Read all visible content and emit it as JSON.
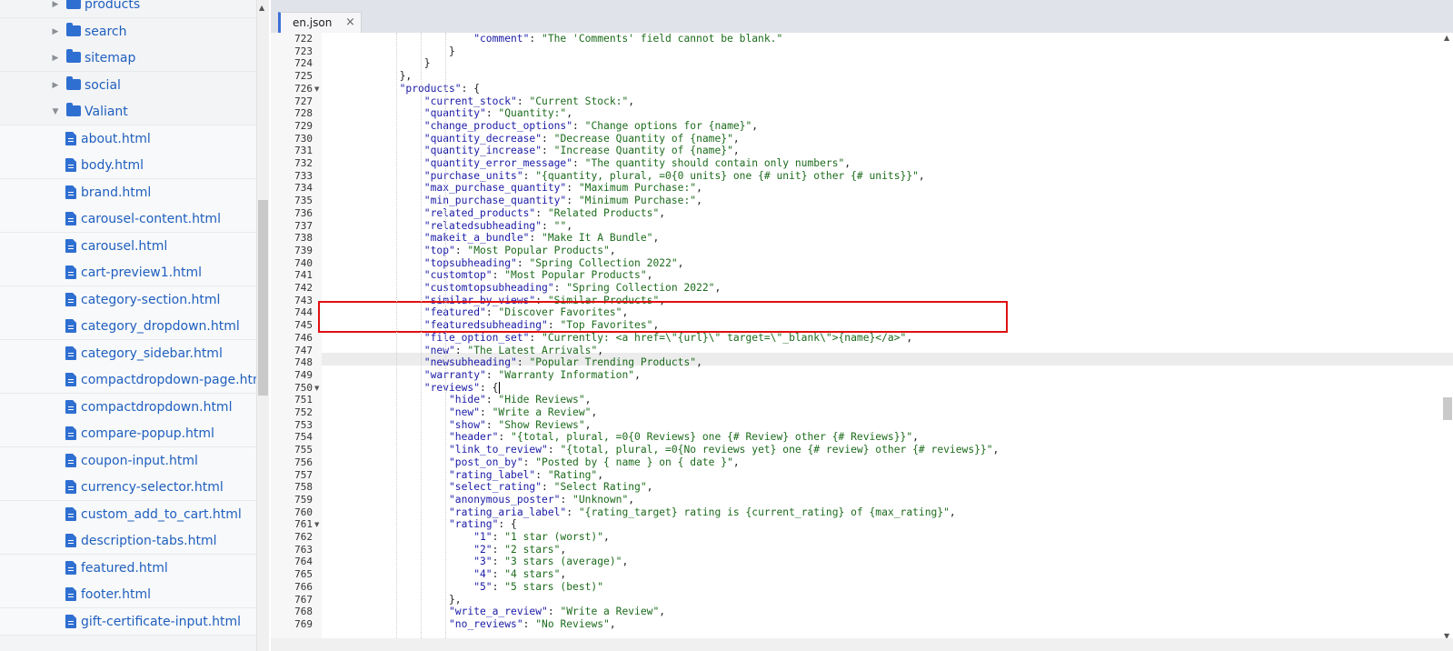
{
  "file_tree": {
    "items": [
      {
        "type": "folder",
        "label": "products",
        "level": 0,
        "expanded": false
      },
      {
        "type": "folder",
        "label": "search",
        "level": 0,
        "expanded": false
      },
      {
        "type": "folder",
        "label": "sitemap",
        "level": 0,
        "expanded": false
      },
      {
        "type": "folder",
        "label": "social",
        "level": 0,
        "expanded": false
      },
      {
        "type": "folder",
        "label": "Valiant",
        "level": 0,
        "expanded": true
      },
      {
        "type": "file",
        "label": "about.html",
        "level": 1
      },
      {
        "type": "file",
        "label": "body.html",
        "level": 1
      },
      {
        "type": "file",
        "label": "brand.html",
        "level": 1
      },
      {
        "type": "file",
        "label": "carousel-content.html",
        "level": 1
      },
      {
        "type": "file",
        "label": "carousel.html",
        "level": 1
      },
      {
        "type": "file",
        "label": "cart-preview1.html",
        "level": 1
      },
      {
        "type": "file",
        "label": "category-section.html",
        "level": 1
      },
      {
        "type": "file",
        "label": "category_dropdown.html",
        "level": 1
      },
      {
        "type": "file",
        "label": "category_sidebar.html",
        "level": 1
      },
      {
        "type": "file",
        "label": "compactdropdown-page.html",
        "level": 1
      },
      {
        "type": "file",
        "label": "compactdropdown.html",
        "level": 1
      },
      {
        "type": "file",
        "label": "compare-popup.html",
        "level": 1
      },
      {
        "type": "file",
        "label": "coupon-input.html",
        "level": 1
      },
      {
        "type": "file",
        "label": "currency-selector.html",
        "level": 1
      },
      {
        "type": "file",
        "label": "custom_add_to_cart.html",
        "level": 1
      },
      {
        "type": "file",
        "label": "description-tabs.html",
        "level": 1
      },
      {
        "type": "file",
        "label": "featured.html",
        "level": 1
      },
      {
        "type": "file",
        "label": "footer.html",
        "level": 1
      },
      {
        "type": "file",
        "label": "gift-certificate-input.html",
        "level": 1
      }
    ]
  },
  "editor": {
    "tab": {
      "label": "en.json",
      "close": "×"
    },
    "active_line": 750,
    "highlighted_lines": [
      744,
      745
    ],
    "lines": [
      {
        "n": 722,
        "indent": 6,
        "text": "\"comment\": \"The 'Comments' field cannot be blank.\""
      },
      {
        "n": 723,
        "indent": 5,
        "text": "}"
      },
      {
        "n": 724,
        "indent": 4,
        "text": "}"
      },
      {
        "n": 725,
        "indent": 3,
        "text": "},"
      },
      {
        "n": 726,
        "indent": 3,
        "text": "\"products\": {",
        "fold": true
      },
      {
        "n": 727,
        "indent": 4,
        "text": "\"current_stock\": \"Current Stock:\","
      },
      {
        "n": 728,
        "indent": 4,
        "text": "\"quantity\": \"Quantity:\","
      },
      {
        "n": 729,
        "indent": 4,
        "text": "\"change_product_options\": \"Change options for {name}\","
      },
      {
        "n": 730,
        "indent": 4,
        "text": "\"quantity_decrease\": \"Decrease Quantity of {name}\","
      },
      {
        "n": 731,
        "indent": 4,
        "text": "\"quantity_increase\": \"Increase Quantity of {name}\","
      },
      {
        "n": 732,
        "indent": 4,
        "text": "\"quantity_error_message\": \"The quantity should contain only numbers\","
      },
      {
        "n": 733,
        "indent": 4,
        "text": "\"purchase_units\": \"{quantity, plural, =0{0 units} one {# unit} other {# units}}\","
      },
      {
        "n": 734,
        "indent": 4,
        "text": "\"max_purchase_quantity\": \"Maximum Purchase:\","
      },
      {
        "n": 735,
        "indent": 4,
        "text": "\"min_purchase_quantity\": \"Minimum Purchase:\","
      },
      {
        "n": 736,
        "indent": 4,
        "text": "\"related_products\": \"Related Products\","
      },
      {
        "n": 737,
        "indent": 4,
        "text": "\"relatedsubheading\": \"\","
      },
      {
        "n": 738,
        "indent": 4,
        "text": "\"makeit_a_bundle\": \"Make It A Bundle\","
      },
      {
        "n": 739,
        "indent": 4,
        "text": "\"top\": \"Most Popular Products\","
      },
      {
        "n": 740,
        "indent": 4,
        "text": "\"topsubheading\": \"Spring Collection 2022\","
      },
      {
        "n": 741,
        "indent": 4,
        "text": "\"customtop\": \"Most Popular Products\","
      },
      {
        "n": 742,
        "indent": 4,
        "text": "\"customtopsubheading\": \"Spring Collection 2022\","
      },
      {
        "n": 743,
        "indent": 4,
        "text": "\"similar_by_views\": \"Similar Products\","
      },
      {
        "n": 744,
        "indent": 4,
        "text": "\"featured\": \"Discover Favorites\","
      },
      {
        "n": 745,
        "indent": 4,
        "text": "\"featuredsubheading\": \"Top Favorites\","
      },
      {
        "n": 746,
        "indent": 4,
        "text": "\"file_option_set\": \"Currently: <a href=\\\"{url}\\\" target=\\\"_blank\\\">{name}</a>\","
      },
      {
        "n": 747,
        "indent": 4,
        "text": "\"new\": \"The Latest Arrivals\","
      },
      {
        "n": 748,
        "indent": 4,
        "text": "\"newsubheading\": \"Popular Trending Products\","
      },
      {
        "n": 749,
        "indent": 4,
        "text": "\"warranty\": \"Warranty Information\","
      },
      {
        "n": 750,
        "indent": 4,
        "text": "\"reviews\": {",
        "fold": true
      },
      {
        "n": 751,
        "indent": 5,
        "text": "\"hide\": \"Hide Reviews\","
      },
      {
        "n": 752,
        "indent": 5,
        "text": "\"new\": \"Write a Review\","
      },
      {
        "n": 753,
        "indent": 5,
        "text": "\"show\": \"Show Reviews\","
      },
      {
        "n": 754,
        "indent": 5,
        "text": "\"header\": \"{total, plural, =0{0 Reviews} one {# Review} other {# Reviews}}\","
      },
      {
        "n": 755,
        "indent": 5,
        "text": "\"link_to_review\": \"{total, plural, =0{No reviews yet} one {# review} other {# reviews}}\","
      },
      {
        "n": 756,
        "indent": 5,
        "text": "\"post_on_by\": \"Posted by { name } on { date }\","
      },
      {
        "n": 757,
        "indent": 5,
        "text": "\"rating_label\": \"Rating\","
      },
      {
        "n": 758,
        "indent": 5,
        "text": "\"select_rating\": \"Select Rating\","
      },
      {
        "n": 759,
        "indent": 5,
        "text": "\"anonymous_poster\": \"Unknown\","
      },
      {
        "n": 760,
        "indent": 5,
        "text": "\"rating_aria_label\": \"{rating_target} rating is {current_rating} of {max_rating}\","
      },
      {
        "n": 761,
        "indent": 5,
        "text": "\"rating\": {",
        "fold": true
      },
      {
        "n": 762,
        "indent": 6,
        "text": "\"1\": \"1 star (worst)\","
      },
      {
        "n": 763,
        "indent": 6,
        "text": "\"2\": \"2 stars\","
      },
      {
        "n": 764,
        "indent": 6,
        "text": "\"3\": \"3 stars (average)\","
      },
      {
        "n": 765,
        "indent": 6,
        "text": "\"4\": \"4 stars\","
      },
      {
        "n": 766,
        "indent": 6,
        "text": "\"5\": \"5 stars (best)\""
      },
      {
        "n": 767,
        "indent": 5,
        "text": "},"
      },
      {
        "n": 768,
        "indent": 5,
        "text": "\"write_a_review\": \"Write a Review\","
      },
      {
        "n": 769,
        "indent": 5,
        "text": "\"no_reviews\": \"No Reviews\","
      }
    ]
  },
  "colors": {
    "key": "#1a1aa6",
    "string": "#1c6b1c",
    "highlight_box": "#e01010",
    "tree_link": "#1f5fbf",
    "folder_icon": "#2f6fd1"
  }
}
